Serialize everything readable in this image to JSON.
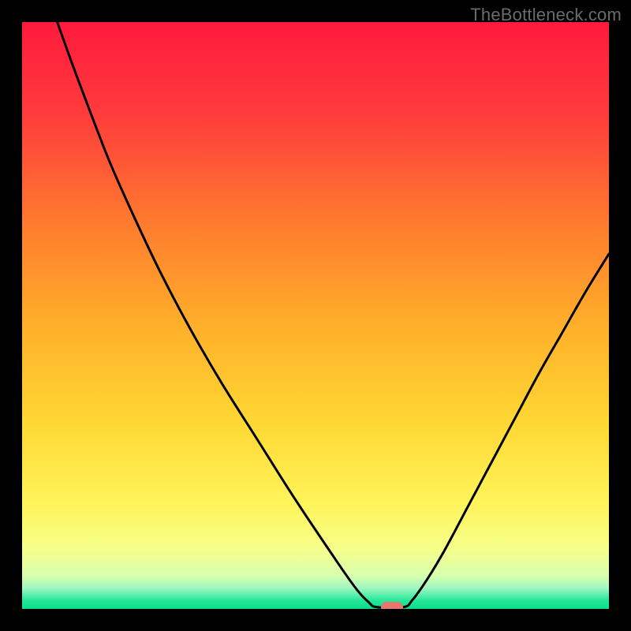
{
  "watermark": "TheBottleneck.com",
  "colors": {
    "frame": "#000000",
    "gradient_stops": [
      {
        "pos": 0.0,
        "color": "#ff1a3c"
      },
      {
        "pos": 0.16,
        "color": "#ff3c3c"
      },
      {
        "pos": 0.34,
        "color": "#ff7a2e"
      },
      {
        "pos": 0.52,
        "color": "#ffb02a"
      },
      {
        "pos": 0.68,
        "color": "#ffd733"
      },
      {
        "pos": 0.82,
        "color": "#fff45a"
      },
      {
        "pos": 0.9,
        "color": "#f5ff8c"
      },
      {
        "pos": 0.945,
        "color": "#d6ffb0"
      },
      {
        "pos": 0.965,
        "color": "#9cf7c0"
      },
      {
        "pos": 0.985,
        "color": "#28e89a"
      },
      {
        "pos": 1.0,
        "color": "#06de87"
      }
    ],
    "curve": "#000000",
    "marker": "#e9766e"
  },
  "chart_data": {
    "type": "line",
    "title": "",
    "xlabel": "",
    "ylabel": "",
    "xlim": [
      0,
      100
    ],
    "ylim": [
      0,
      100
    ],
    "grid": false,
    "legend": false,
    "left_branch": [
      {
        "x": 6.0,
        "y": 100.0
      },
      {
        "x": 8.5,
        "y": 93.0
      },
      {
        "x": 11.5,
        "y": 85.0
      },
      {
        "x": 15.0,
        "y": 76.0
      },
      {
        "x": 19.0,
        "y": 67.0
      },
      {
        "x": 23.5,
        "y": 57.5
      },
      {
        "x": 28.5,
        "y": 48.0
      },
      {
        "x": 34.0,
        "y": 38.5
      },
      {
        "x": 40.0,
        "y": 29.0
      },
      {
        "x": 46.0,
        "y": 19.5
      },
      {
        "x": 52.0,
        "y": 10.5
      },
      {
        "x": 56.5,
        "y": 4.0
      },
      {
        "x": 59.0,
        "y": 1.2
      },
      {
        "x": 60.5,
        "y": 0.3
      }
    ],
    "flat_segment": [
      {
        "x": 60.5,
        "y": 0.3
      },
      {
        "x": 65.0,
        "y": 0.3
      }
    ],
    "right_branch": [
      {
        "x": 65.0,
        "y": 0.3
      },
      {
        "x": 66.5,
        "y": 1.5
      },
      {
        "x": 69.0,
        "y": 5.0
      },
      {
        "x": 72.0,
        "y": 10.0
      },
      {
        "x": 76.0,
        "y": 17.5
      },
      {
        "x": 80.0,
        "y": 25.0
      },
      {
        "x": 84.0,
        "y": 32.5
      },
      {
        "x": 88.0,
        "y": 40.0
      },
      {
        "x": 92.0,
        "y": 47.0
      },
      {
        "x": 96.0,
        "y": 54.0
      },
      {
        "x": 100.0,
        "y": 60.5
      }
    ],
    "marker": {
      "x": 63.0,
      "y": 0.3
    }
  }
}
